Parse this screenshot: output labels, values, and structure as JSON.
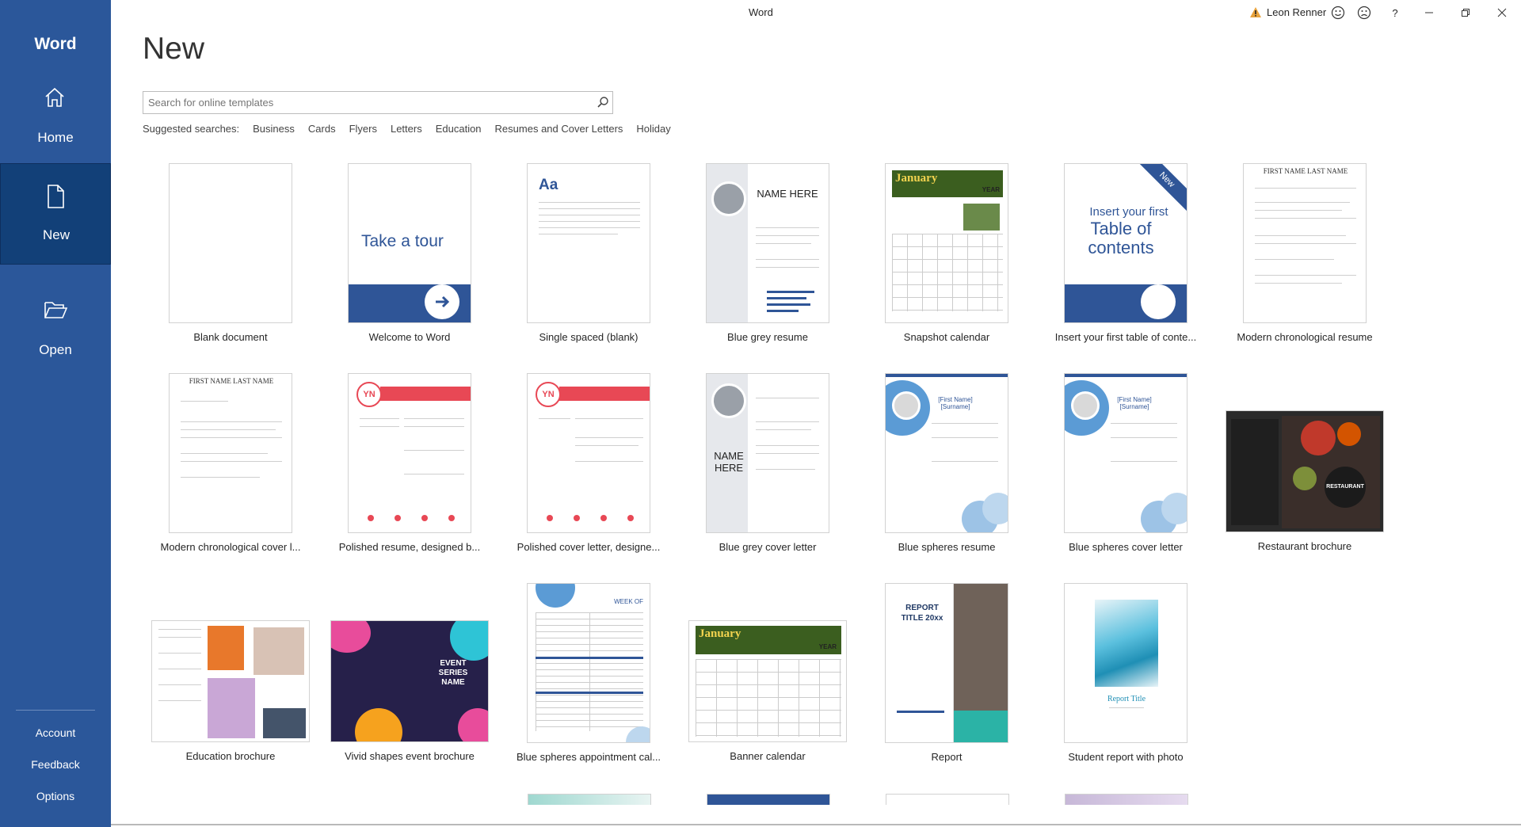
{
  "window": {
    "title": "Word",
    "user_name": "Leon Renner",
    "warning_icon": "warning-icon",
    "controls": [
      "smiley-icon",
      "frown-icon",
      "help-icon",
      "minimize-icon",
      "restore-icon",
      "close-icon"
    ]
  },
  "sidebar": {
    "brand": "Word",
    "items": [
      {
        "label": "Home",
        "icon": "home-icon"
      },
      {
        "label": "New",
        "icon": "new-document-icon"
      },
      {
        "label": "Open",
        "icon": "folder-open-icon"
      }
    ],
    "bottom": [
      "Account",
      "Feedback",
      "Options"
    ]
  },
  "main": {
    "title": "New",
    "search": {
      "placeholder": "Search for online templates",
      "value": ""
    },
    "suggested": {
      "label": "Suggested searches:",
      "items": [
        "Business",
        "Cards",
        "Flyers",
        "Letters",
        "Education",
        "Resumes and Cover Letters",
        "Holiday"
      ]
    },
    "templates": [
      {
        "name": "Blank document"
      },
      {
        "name": "Welcome to Word",
        "thumb_text": "Take a tour"
      },
      {
        "name": "Single spaced (blank)",
        "thumb_text": "Aa"
      },
      {
        "name": "Blue grey resume",
        "thumb_text": "NAME HERE"
      },
      {
        "name": "Snapshot calendar",
        "thumb_text": "January",
        "thumb_text2": "YEAR"
      },
      {
        "name": "Insert your first table of conte...",
        "thumb_text": "Insert your first",
        "thumb_text2": "Table of contents",
        "badge": "New"
      },
      {
        "name": "Modern chronological resume",
        "thumb_text": "FIRST NAME LAST NAME"
      },
      {
        "name": "Modern chronological cover l...",
        "thumb_text": "FIRST NAME LAST NAME"
      },
      {
        "name": "Polished resume, designed b...",
        "thumb_text": "YN"
      },
      {
        "name": "Polished cover letter, designe...",
        "thumb_text": "YN"
      },
      {
        "name": "Blue grey cover letter",
        "thumb_text": "NAME HERE"
      },
      {
        "name": "Blue spheres resume",
        "thumb_text": "[First Name] [Surname]"
      },
      {
        "name": "Blue spheres cover letter",
        "thumb_text": "[First Name] [Surname]"
      },
      {
        "name": "Restaurant brochure",
        "thumb_text": "RESTAURANT"
      },
      {
        "name": "Education brochure"
      },
      {
        "name": "Vivid shapes event brochure",
        "thumb_text": "EVENT SERIES NAME"
      },
      {
        "name": "Blue spheres appointment cal...",
        "thumb_text": "WEEK OF"
      },
      {
        "name": "Banner calendar",
        "thumb_text": "January",
        "thumb_text2": "YEAR"
      },
      {
        "name": "Report",
        "thumb_text": "REPORT TITLE 20xx"
      },
      {
        "name": "Student report with photo",
        "thumb_text": "Report Title"
      }
    ]
  },
  "colors": {
    "brand": "#2b579a",
    "accent_blue": "#2f5597",
    "calendar_green": "#3b5e1f",
    "polished_red": "#e84855"
  }
}
